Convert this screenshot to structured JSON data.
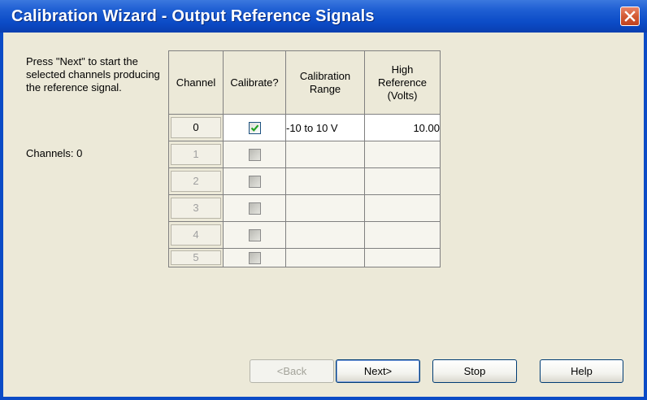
{
  "window": {
    "title": "Calibration Wizard - Output Reference Signals"
  },
  "instructions": {
    "text": "Press \"Next\" to start the selected channels producing the reference signal.",
    "channels_label": "Channels: 0"
  },
  "table": {
    "headers": {
      "channel": "Channel",
      "calibrate": "Calibrate?",
      "range_line1": "Calibration",
      "range_line2": "Range",
      "high_line1": "High",
      "high_line2": "Reference",
      "high_line3": "(Volts)"
    },
    "rows": [
      {
        "channel": "0",
        "checked": true,
        "range": "-10 to 10 V",
        "high": "10.00",
        "enabled": true
      },
      {
        "channel": "1",
        "checked": false,
        "range": "",
        "high": "",
        "enabled": false
      },
      {
        "channel": "2",
        "checked": false,
        "range": "",
        "high": "",
        "enabled": false
      },
      {
        "channel": "3",
        "checked": false,
        "range": "",
        "high": "",
        "enabled": false
      },
      {
        "channel": "4",
        "checked": false,
        "range": "",
        "high": "",
        "enabled": false
      },
      {
        "channel": "5",
        "checked": false,
        "range": "",
        "high": "",
        "enabled": false
      }
    ]
  },
  "buttons": {
    "back": "<Back",
    "next": "Next>",
    "stop": "Stop",
    "help": "Help"
  },
  "icons": {
    "close": "close-icon",
    "check": "check-icon"
  },
  "colors": {
    "titlebar": "#0b4bc6",
    "close_button": "#d35a35",
    "check": "#21a121",
    "dialog_face": "#ece9d8"
  }
}
